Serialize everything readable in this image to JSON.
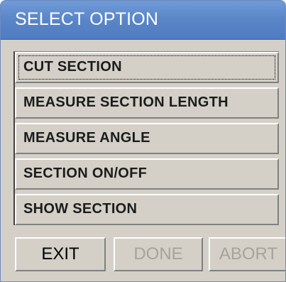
{
  "window": {
    "title": "SELECT OPTION"
  },
  "options": [
    {
      "label": "CUT SECTION",
      "focused": true
    },
    {
      "label": "MEASURE SECTION LENGTH",
      "focused": false
    },
    {
      "label": "MEASURE ANGLE",
      "focused": false
    },
    {
      "label": "SECTION ON/OFF",
      "focused": false
    },
    {
      "label": "SHOW SECTION",
      "focused": false
    }
  ],
  "buttons": {
    "exit": {
      "label": "EXIT",
      "enabled": true
    },
    "done": {
      "label": "DONE",
      "enabled": false
    },
    "abort": {
      "label": "ABORT",
      "enabled": false
    }
  }
}
